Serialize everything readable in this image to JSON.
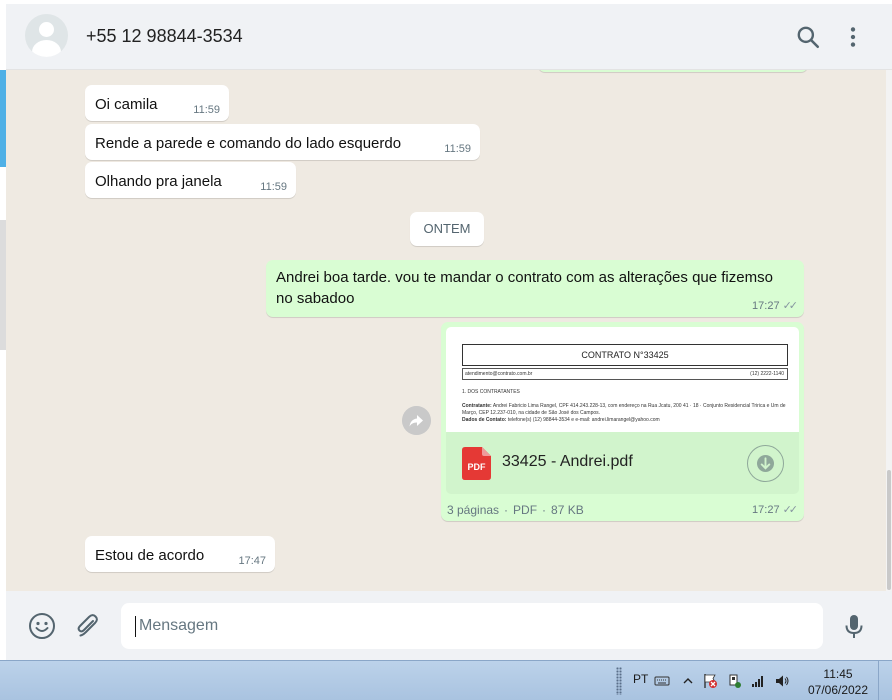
{
  "header": {
    "contact_name": "+55 12 98844-3534",
    "icons": [
      "search-icon",
      "menu-dots-icon"
    ]
  },
  "messages": [
    {
      "direction": "in",
      "text": "Oi camila",
      "time": "11:59"
    },
    {
      "direction": "in",
      "text": "Rende a parede e comando do lado esquerdo",
      "time": "11:59"
    },
    {
      "direction": "in",
      "text": "Olhando pra janela",
      "time": "11:59"
    },
    {
      "direction": "out",
      "line1": "Andrei boa tarde. vou te mandar o contrato com as alterações que fizemso",
      "line2": "no sabadoo",
      "time": "17:27"
    },
    {
      "direction": "in",
      "text": "Estou de acordo",
      "time": "17:47"
    }
  ],
  "day_chip": "ONTEM",
  "document": {
    "preview_title": "CONTRATO N°33425",
    "preview_email": "atendimento@contrato.com.br",
    "preview_phone": "(12) 2222-1140",
    "preview_section": "1. DOS CONTRATANTES",
    "preview_bold1": "Contratante:",
    "preview_text1": "Andrei Fabricio Lima Rangel, CPF 414.243.228-13, com endereço na Rua Jcatu, 200 41 · 18 · Conjunto Residencial Tririca e Um de Março, CEP 12.237-010, na cidade de São José dos Campos.",
    "preview_bold2": "Dados de Contato:",
    "preview_text2": "telefone(s) (12) 98844-3534 e e-mail: andrei.limarangel@yahoo.com",
    "file_badge": "PDF",
    "file_name": "33425 - Andrei.pdf",
    "pages": "3 páginas",
    "type": "PDF",
    "size": "87 KB",
    "time": "17:27"
  },
  "footer": {
    "placeholder": "Mensagem",
    "icons": [
      "emoji-icon",
      "attach-icon",
      "mic-icon"
    ]
  },
  "taskbar": {
    "language": "PT",
    "time": "11:45",
    "date": "07/06/2022"
  },
  "colors": {
    "chat_bg": "#efeae2",
    "outgoing": "#d9fdd3",
    "incoming": "#ffffff",
    "pdf_red": "#e53935"
  }
}
